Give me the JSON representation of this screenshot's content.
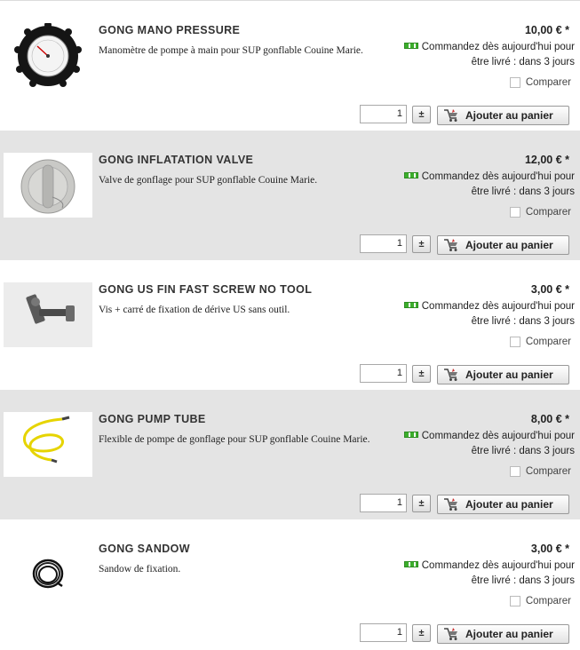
{
  "products": [
    {
      "name": "GONG MANO PRESSURE",
      "description": "Manomètre de pompe à main pour SUP gonflable Couine Marie.",
      "price": "10,00 € *",
      "stock_line1": "Commandez dès aujourd'hui pour",
      "stock_line2": "être livré : dans 3 jours",
      "compare_label": "Comparer",
      "quantity": "1",
      "qty_toggle": "±",
      "add_label": "Ajouter au panier",
      "image_icon": "pressure-gauge-icon"
    },
    {
      "name": "GONG INFLATATION VALVE",
      "description": "Valve de gonflage pour SUP gonflable Couine Marie.",
      "price": "12,00 € *",
      "stock_line1": "Commandez dès aujourd'hui pour",
      "stock_line2": "être livré : dans 3 jours",
      "compare_label": "Comparer",
      "quantity": "1",
      "qty_toggle": "±",
      "add_label": "Ajouter au panier",
      "image_icon": "valve-icon"
    },
    {
      "name": "GONG US FIN FAST SCREW NO TOOL",
      "description": "Vis + carré de fixation de dérive US sans outil.",
      "price": "3,00 € *",
      "stock_line1": "Commandez dès aujourd'hui pour",
      "stock_line2": "être livré : dans 3 jours",
      "compare_label": "Comparer",
      "quantity": "1",
      "qty_toggle": "±",
      "add_label": "Ajouter au panier",
      "image_icon": "screw-icon"
    },
    {
      "name": "GONG PUMP TUBE",
      "description": "Flexible de pompe de gonflage pour SUP gonflable Couine Marie.",
      "price": "8,00 € *",
      "stock_line1": "Commandez dès aujourd'hui pour",
      "stock_line2": "être livré : dans 3 jours",
      "compare_label": "Comparer",
      "quantity": "1",
      "qty_toggle": "±",
      "add_label": "Ajouter au panier",
      "image_icon": "pump-tube-icon"
    },
    {
      "name": "GONG SANDOW",
      "description": "Sandow de fixation.",
      "price": "3,00 € *",
      "stock_line1": "Commandez dès aujourd'hui pour",
      "stock_line2": "être livré : dans 3 jours",
      "compare_label": "Comparer",
      "quantity": "1",
      "qty_toggle": "±",
      "add_label": "Ajouter au panier",
      "image_icon": "bungee-cord-icon"
    }
  ],
  "colors": {
    "stock_green": "#3cae2c",
    "alt_row_bg": "#e4e4e4"
  }
}
